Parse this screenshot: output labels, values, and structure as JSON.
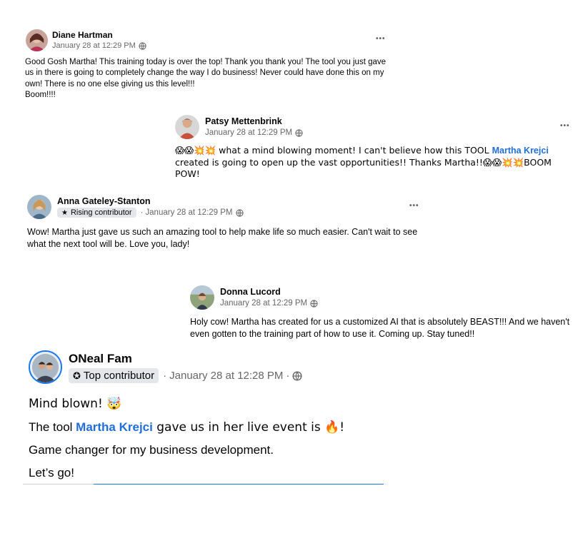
{
  "comments": [
    {
      "author": "Diane Hartman",
      "timestamp": "January 28 at 12:29 PM",
      "text": "Good Gosh Martha! This training today is over the top! Thank you thank you! The tool you just gave us in there is going to completely change the way I do business! Never could have done this on my own! There is no one else giving us this level!!!",
      "text2": "Boom!!!!",
      "more": "•••",
      "avatar_icon": "profile-photo"
    },
    {
      "author": "Patsy Mettenbrink",
      "timestamp": "January 28 at 12:29 PM",
      "text_before": "😱😱💥💥 what a mind blowing moment! I can't believe how this TOOL ",
      "mention": "Martha Krejci",
      "text_after": " created is going to open up the vast opportunities!! Thanks Martha!!😱😱💥💥BOOM POW!",
      "more": "•••",
      "avatar_icon": "profile-photo"
    },
    {
      "author": "Anna Gateley-Stanton",
      "badge": "Rising contributor",
      "badge_icon": "star-icon",
      "timestamp": "January 28 at 12:29 PM",
      "text": "Wow! Martha just gave us such an amazing tool to help make life so much easier. Can't wait to see what the next tool will be. Love you, lady!",
      "more": "•••",
      "avatar_icon": "profile-photo"
    },
    {
      "author": "Donna Lucord",
      "timestamp": "January 28 at 12:29 PM",
      "text": "Holy cow!  Martha has created for us a customized AI that is absolutely BEAST!!!  And we haven't even gotten to the training part of how to use it.  Coming up.  Stay tuned!!",
      "avatar_icon": "profile-photo"
    },
    {
      "author": "ONeal Fam",
      "badge": "Top contributor",
      "badge_icon": "award-icon",
      "timestamp": "January 28 at 12:28 PM",
      "line1": "Mind blown! 🤯",
      "line2_before": "The tool ",
      "mention": "Martha Krejci",
      "line2_after": " gave us in her live event is 🔥!",
      "line3": "Game changer for my business development.",
      "line4": "Let’s go!",
      "avatar_icon": "profile-photo"
    }
  ],
  "colors": {
    "mention": "#216fdb",
    "meta": "#65676b",
    "ring": "#1877f2"
  }
}
